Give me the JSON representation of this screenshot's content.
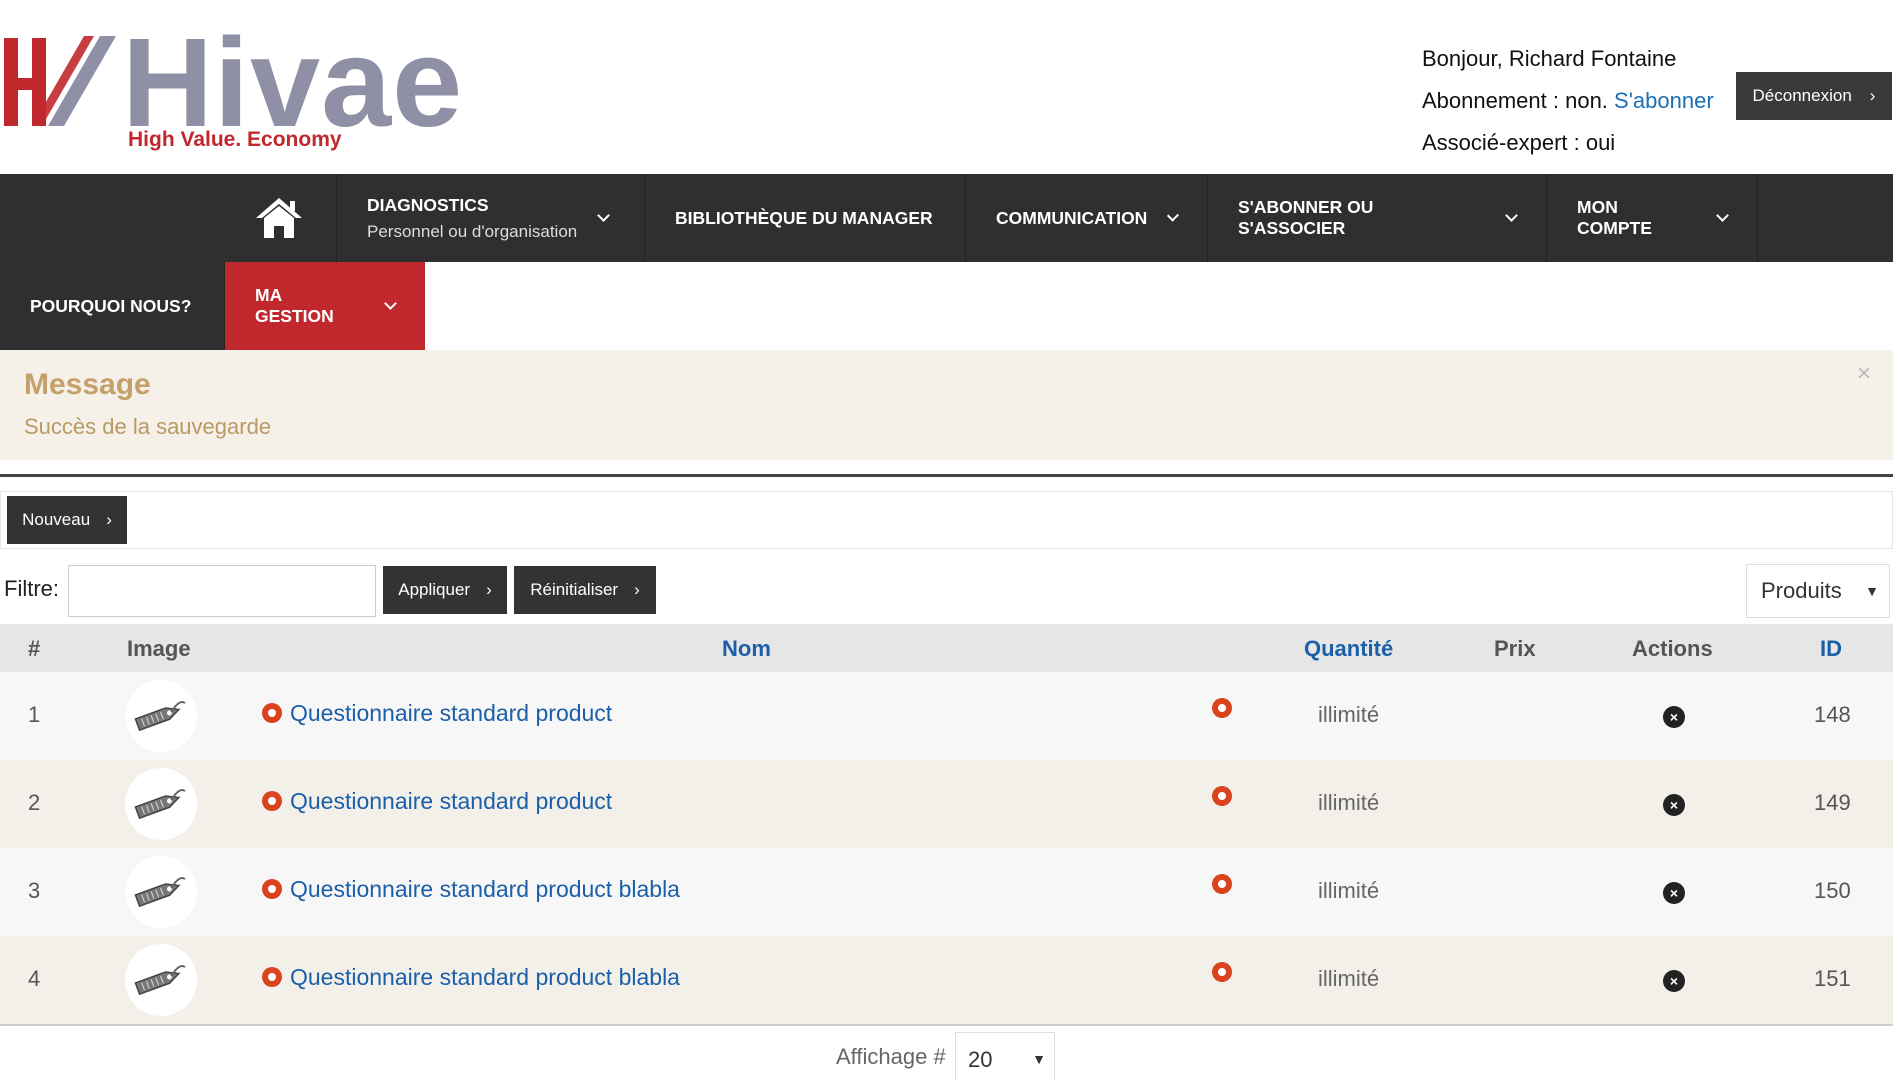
{
  "header": {
    "brand": "Hivae",
    "tagline_a": "High Value.",
    "tagline_b": " Economy",
    "greeting": "Bonjour, Richard Fontaine",
    "subscription_label": "Abonnement : non. ",
    "subscribe_link": "S'abonner",
    "expert_label": "Associé-expert : oui",
    "logout_label": "Déconnexion"
  },
  "nav": {
    "diagnostics": "DIAGNOSTICS",
    "diagnostics_sub": "Personnel ou d'organisation",
    "library": "BIBLIOTHÈQUE DU MANAGER",
    "communication": "COMMUNICATION",
    "subscribe": "S'ABONNER OU S'ASSOCIER",
    "account": "MON COMPTE",
    "why": "POURQUOI NOUS?",
    "management": "MA GESTION"
  },
  "message": {
    "title": "Message",
    "text": "Succès de la sauvegarde",
    "close": "×"
  },
  "toolbar": {
    "new_label": "Nouveau",
    "filter_label": "Filtre:",
    "filter_value": "",
    "apply_label": "Appliquer",
    "reset_label": "Réinitialiser",
    "type_select": "Produits"
  },
  "table": {
    "columns": [
      "#",
      "Image",
      "Nom",
      "Quantité",
      "Prix",
      "Actions",
      "ID"
    ],
    "rows": [
      {
        "num": "1",
        "name": "Questionnaire standard product",
        "qty": "illimité",
        "price": "",
        "id": "148"
      },
      {
        "num": "2",
        "name": "Questionnaire standard product",
        "qty": "illimité",
        "price": "",
        "id": "149"
      },
      {
        "num": "3",
        "name": "Questionnaire standard product blabla",
        "qty": "illimité",
        "price": "",
        "id": "150"
      },
      {
        "num": "4",
        "name": "Questionnaire standard product blabla",
        "qty": "illimité",
        "price": "",
        "id": "151"
      }
    ]
  },
  "footer": {
    "display_label": "Affichage #",
    "page_size": "20"
  },
  "colors": {
    "accent_red": "#c0282e",
    "nav_dark": "#2f2f2f",
    "link_blue": "#1b5fa8",
    "status_orange": "#d9431e"
  },
  "icons": {
    "home": "home-icon",
    "product": "price-tag-icon",
    "delete": "close-circle-icon"
  }
}
